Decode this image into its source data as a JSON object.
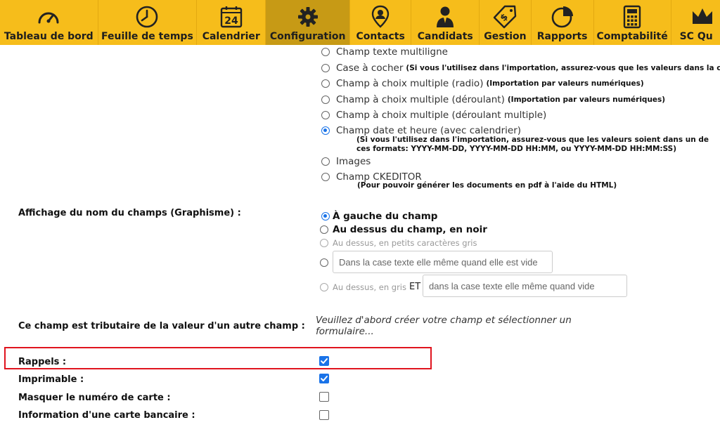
{
  "nav": {
    "items": [
      {
        "label": "Tableau de bord",
        "icon": "gauge-icon"
      },
      {
        "label": "Feuille de temps",
        "icon": "clock-icon"
      },
      {
        "label": "Calendrier",
        "icon": "calendar-icon",
        "day": "24"
      },
      {
        "label": "Configuration",
        "icon": "gear-icon",
        "active": true
      },
      {
        "label": "Contacts",
        "icon": "contact-pin-icon"
      },
      {
        "label": "Candidats",
        "icon": "candidate-icon"
      },
      {
        "label": "Gestion",
        "icon": "price-tag-icon"
      },
      {
        "label": "Rapports",
        "icon": "pie-chart-icon"
      },
      {
        "label": "Comptabilité",
        "icon": "calculator-icon"
      },
      {
        "label": "SC Qu",
        "icon": "crown-icon"
      }
    ]
  },
  "field_types": {
    "multiline": "Champ texte multiligne",
    "checkbox": "Case à cocher",
    "checkbox_note": "(Si vous l'utilisez dans l'importation, assurez-vous que les valeurs dans la co",
    "radio": "Champ à choix multiple (radio)",
    "radio_note": "(Importation par valeurs numériques)",
    "dropdown": "Champ à choix multiple (déroulant)",
    "dropdown_note": "(Importation par valeurs numériques)",
    "dropdown_multi": "Champ à choix multiple (déroulant multiple)",
    "datetime": "Champ date et heure (avec calendrier)",
    "datetime_note_1": "(Si vous l'utilisez dans l'importation, assurez-vous que les valeurs soient dans un de",
    "datetime_note_2": "ces formats: YYYY-MM-DD, YYYY-MM-DD HH:MM, ou YYYY-MM-DD HH:MM:SS)",
    "images": "Images",
    "ckeditor": "Champ CKEDITOR",
    "ckeditor_note": "(Pour pouvoir générer les documents en pdf à l'aide du HTML)"
  },
  "display": {
    "label": "Affichage du nom du champs (Graphisme) :",
    "left": "À gauche du champ",
    "above_black": "Au dessus du champ, en noir",
    "above_small_gray": "Au dessus, en petits caractères gris",
    "inside_box": "Dans la case texte elle même quand elle est vide",
    "above_gray": "Au dessus, en gris",
    "et": "ET",
    "inside_box_2": "dans la case texte elle même quand vide"
  },
  "dependent": {
    "label": "Ce champ est tributaire de la valeur d'un autre champ :",
    "message": "Veuillez d'abord créer votre champ et sélectionner un formulaire..."
  },
  "options": {
    "rappels": "Rappels :",
    "imprimable": "Imprimable :",
    "masquer": "Masquer le numéro de carte :",
    "bancaire": "Information d'une carte bancaire :"
  },
  "colors": {
    "nav_bg": "#f6bd1b",
    "nav_active": "#c79a15",
    "accent": "#1a73e8",
    "highlight": "#e0141e"
  }
}
